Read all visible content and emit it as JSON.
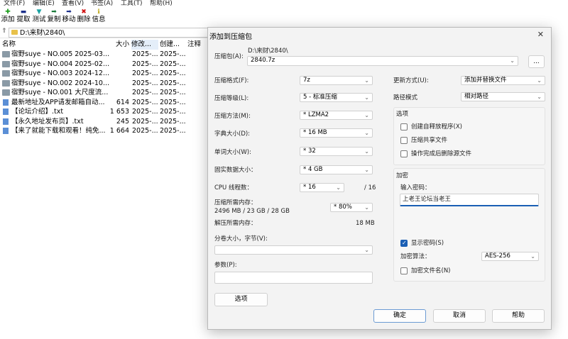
{
  "menu": [
    "文件(F)",
    "编辑(E)",
    "查看(V)",
    "书签(A)",
    "工具(T)",
    "帮助(H)"
  ],
  "toolbar": [
    {
      "label": "添加",
      "icon": "plus-icon",
      "color": "#1a9c1a"
    },
    {
      "label": "提取",
      "icon": "minus-icon",
      "color": "#1b2f8a"
    },
    {
      "label": "测试",
      "icon": "check-icon",
      "color": "#1aa3a3"
    },
    {
      "label": "复制",
      "icon": "arrow-right-icon",
      "color": "#1a7a3a"
    },
    {
      "label": "移动",
      "icon": "arrow-right-icon",
      "color": "#1b2f8a"
    },
    {
      "label": "删除",
      "icon": "delete-x-icon",
      "color": "#d01010"
    },
    {
      "label": "信息",
      "icon": "info-icon",
      "color": "#b8a000"
    }
  ],
  "address": "D:\\来财\\2840\\",
  "columns": [
    "名称",
    "大小",
    "修改...",
    "创建...",
    "注释"
  ],
  "files": [
    {
      "name": "宿野suye - NO.005 2025-03...",
      "size": "",
      "modified": "2025-...",
      "created": "2025-...",
      "type": "folder"
    },
    {
      "name": "宿野suye - NO.004 2025-02...",
      "size": "",
      "modified": "2025-...",
      "created": "2025-...",
      "type": "folder"
    },
    {
      "name": "宿野suye - NO.003 2024-12...",
      "size": "",
      "modified": "2025-...",
      "created": "2025-...",
      "type": "folder"
    },
    {
      "name": "宿野suye - NO.002 2024-10...",
      "size": "",
      "modified": "2025-...",
      "created": "2025-...",
      "type": "folder"
    },
    {
      "name": "宿野suye - NO.001 大尺度流...",
      "size": "",
      "modified": "2025-...",
      "created": "2025-...",
      "type": "folder"
    },
    {
      "name": "最新地址及APP请发邮箱自动...",
      "size": "614",
      "modified": "2025-...",
      "created": "2025-...",
      "type": "file"
    },
    {
      "name": "【论坛介绍】.txt",
      "size": "1 653",
      "modified": "2025-...",
      "created": "2025-...",
      "type": "file"
    },
    {
      "name": "【永久地址发布页】.txt",
      "size": "245",
      "modified": "2025-...",
      "created": "2025-...",
      "type": "file"
    },
    {
      "name": "【来了就能下载和观看！纯免...",
      "size": "1 664",
      "modified": "2025-...",
      "created": "2025-...",
      "type": "file"
    }
  ],
  "dialog": {
    "title": "添加到压缩包",
    "archive_label": "压缩包(A):",
    "archive_dir": "D:\\来财\\2840\\",
    "archive_name": "2840.7z",
    "browse": "...",
    "format_label": "压缩格式(F):",
    "format": "7z",
    "level_label": "压缩等级(L):",
    "level": "5 - 标准压缩",
    "method_label": "压缩方法(M):",
    "method": "* LZMA2",
    "dict_label": "字典大小(D):",
    "dict": "* 16 MB",
    "word_label": "单词大小(W):",
    "word": "* 32",
    "solid_label": "固实数据大小：",
    "solid": "* 4 GB",
    "threads_label": "CPU 线程数：",
    "threads": "* 16",
    "threads_total": "/ 16",
    "mem_comp_label": "压缩所需内存：",
    "mem_comp": "2496 MB / 23 GB / 28 GB",
    "mem_pct": "* 80%",
    "mem_decomp_label": "解压所需内存：",
    "mem_decomp": "18 MB",
    "split_label": "分卷大小，字节(V):",
    "split": "",
    "params_label": "参数(P):",
    "params": "",
    "options_button": "选项",
    "update_label": "更新方式(U):",
    "update": "添加并替换文件",
    "path_label": "路径模式",
    "path": "相对路径",
    "options_group": "选项",
    "opt_sfx": "创建自释放程序(X)",
    "opt_shared": "压缩共享文件",
    "opt_delete": "操作完成后删除源文件",
    "encrypt_group": "加密",
    "password_label": "输入密码：",
    "password": "上老王论坛当老王",
    "show_password": "显示密码(S)",
    "enc_method_label": "加密算法：",
    "enc_method": "AES-256",
    "encrypt_names": "加密文件名(N)",
    "ok": "确定",
    "cancel": "取消",
    "help": "帮助"
  }
}
